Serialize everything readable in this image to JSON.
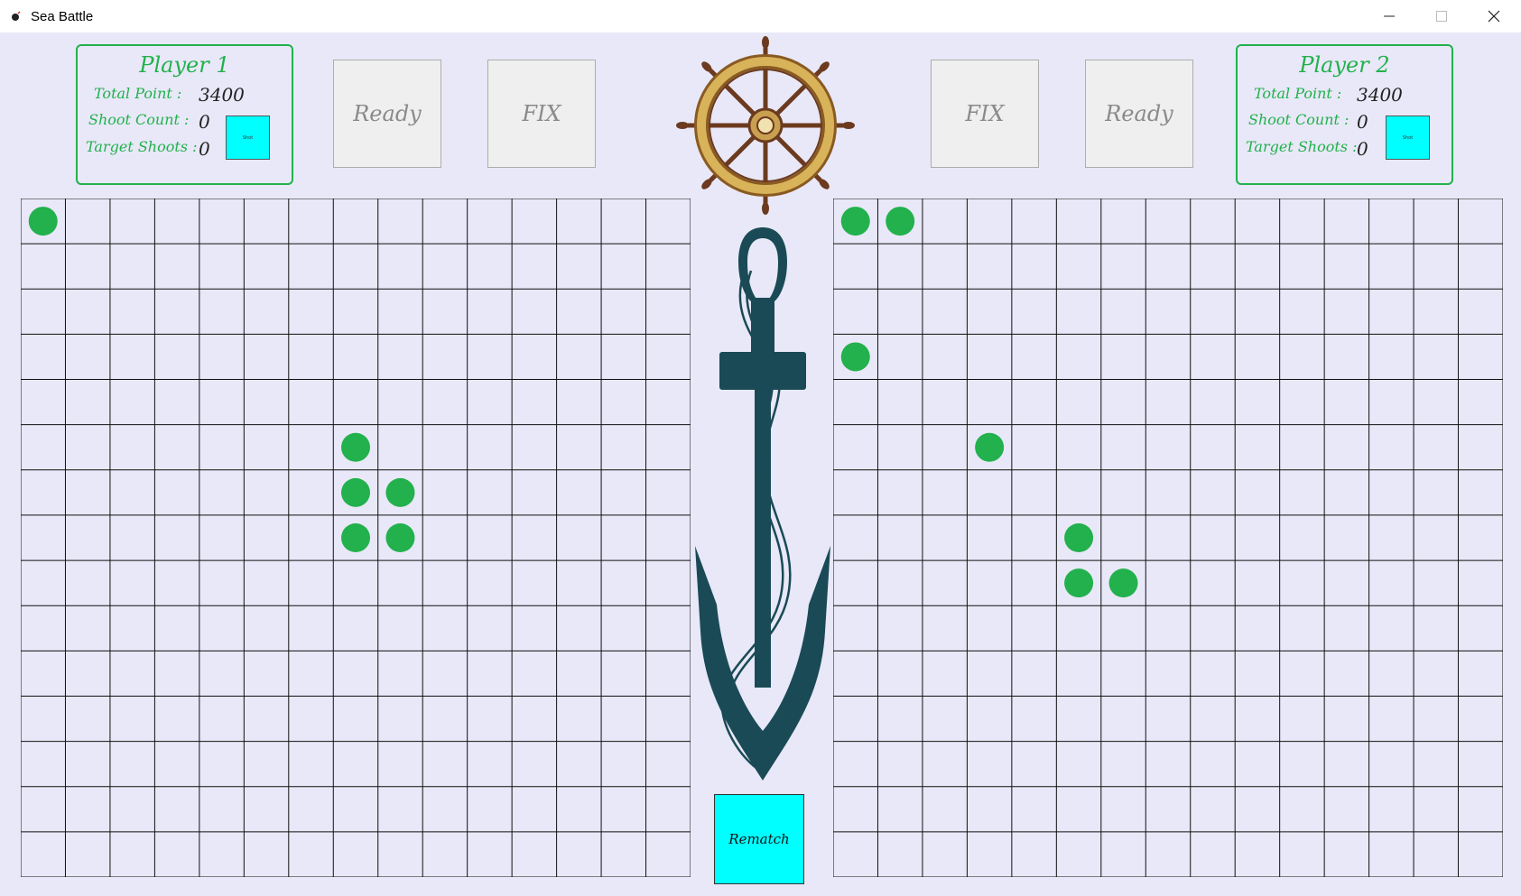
{
  "window": {
    "title": "Sea Battle"
  },
  "player1": {
    "name": "Player 1",
    "total_point_label": "Total Point :",
    "total_point": "3400",
    "shoot_count_label": "Shoot Count :",
    "shoot_count": "0",
    "target_shoots_label": "Target Shoots :",
    "target_shoots": "0",
    "indicator_text": "Shot"
  },
  "player2": {
    "name": "Player 2",
    "total_point_label": "Total Point :",
    "total_point": "3400",
    "shoot_count_label": "Shoot Count :",
    "shoot_count": "0",
    "target_shoots_label": "Target Shoots :",
    "target_shoots": "0",
    "indicator_text": "Shot"
  },
  "buttons": {
    "p1_ready": "Ready",
    "p1_fix": "FIX",
    "p2_fix": "FIX",
    "p2_ready": "Ready",
    "rematch": "Rematch"
  },
  "boards": {
    "rows": 15,
    "cols": 15,
    "marker_color": "#22b14c",
    "left_markers": [
      [
        0,
        0
      ],
      [
        5,
        7
      ],
      [
        6,
        7
      ],
      [
        6,
        8
      ],
      [
        7,
        7
      ],
      [
        7,
        8
      ]
    ],
    "right_markers": [
      [
        0,
        0
      ],
      [
        0,
        1
      ],
      [
        3,
        0
      ],
      [
        5,
        3
      ],
      [
        7,
        5
      ],
      [
        8,
        5
      ],
      [
        8,
        6
      ]
    ]
  },
  "colors": {
    "background": "#e8e8f8",
    "accent_green": "#22b14c",
    "cyan": "#00ffff",
    "anchor": "#1a4a55",
    "wheel_gold": "#c9a050",
    "wheel_wood": "#6b3a1f"
  },
  "icons": {
    "app": "bomb-icon",
    "minimize": "minimize-icon",
    "maximize": "maximize-icon",
    "close": "close-icon",
    "wheel": "ship-wheel-icon",
    "anchor": "anchor-icon"
  }
}
